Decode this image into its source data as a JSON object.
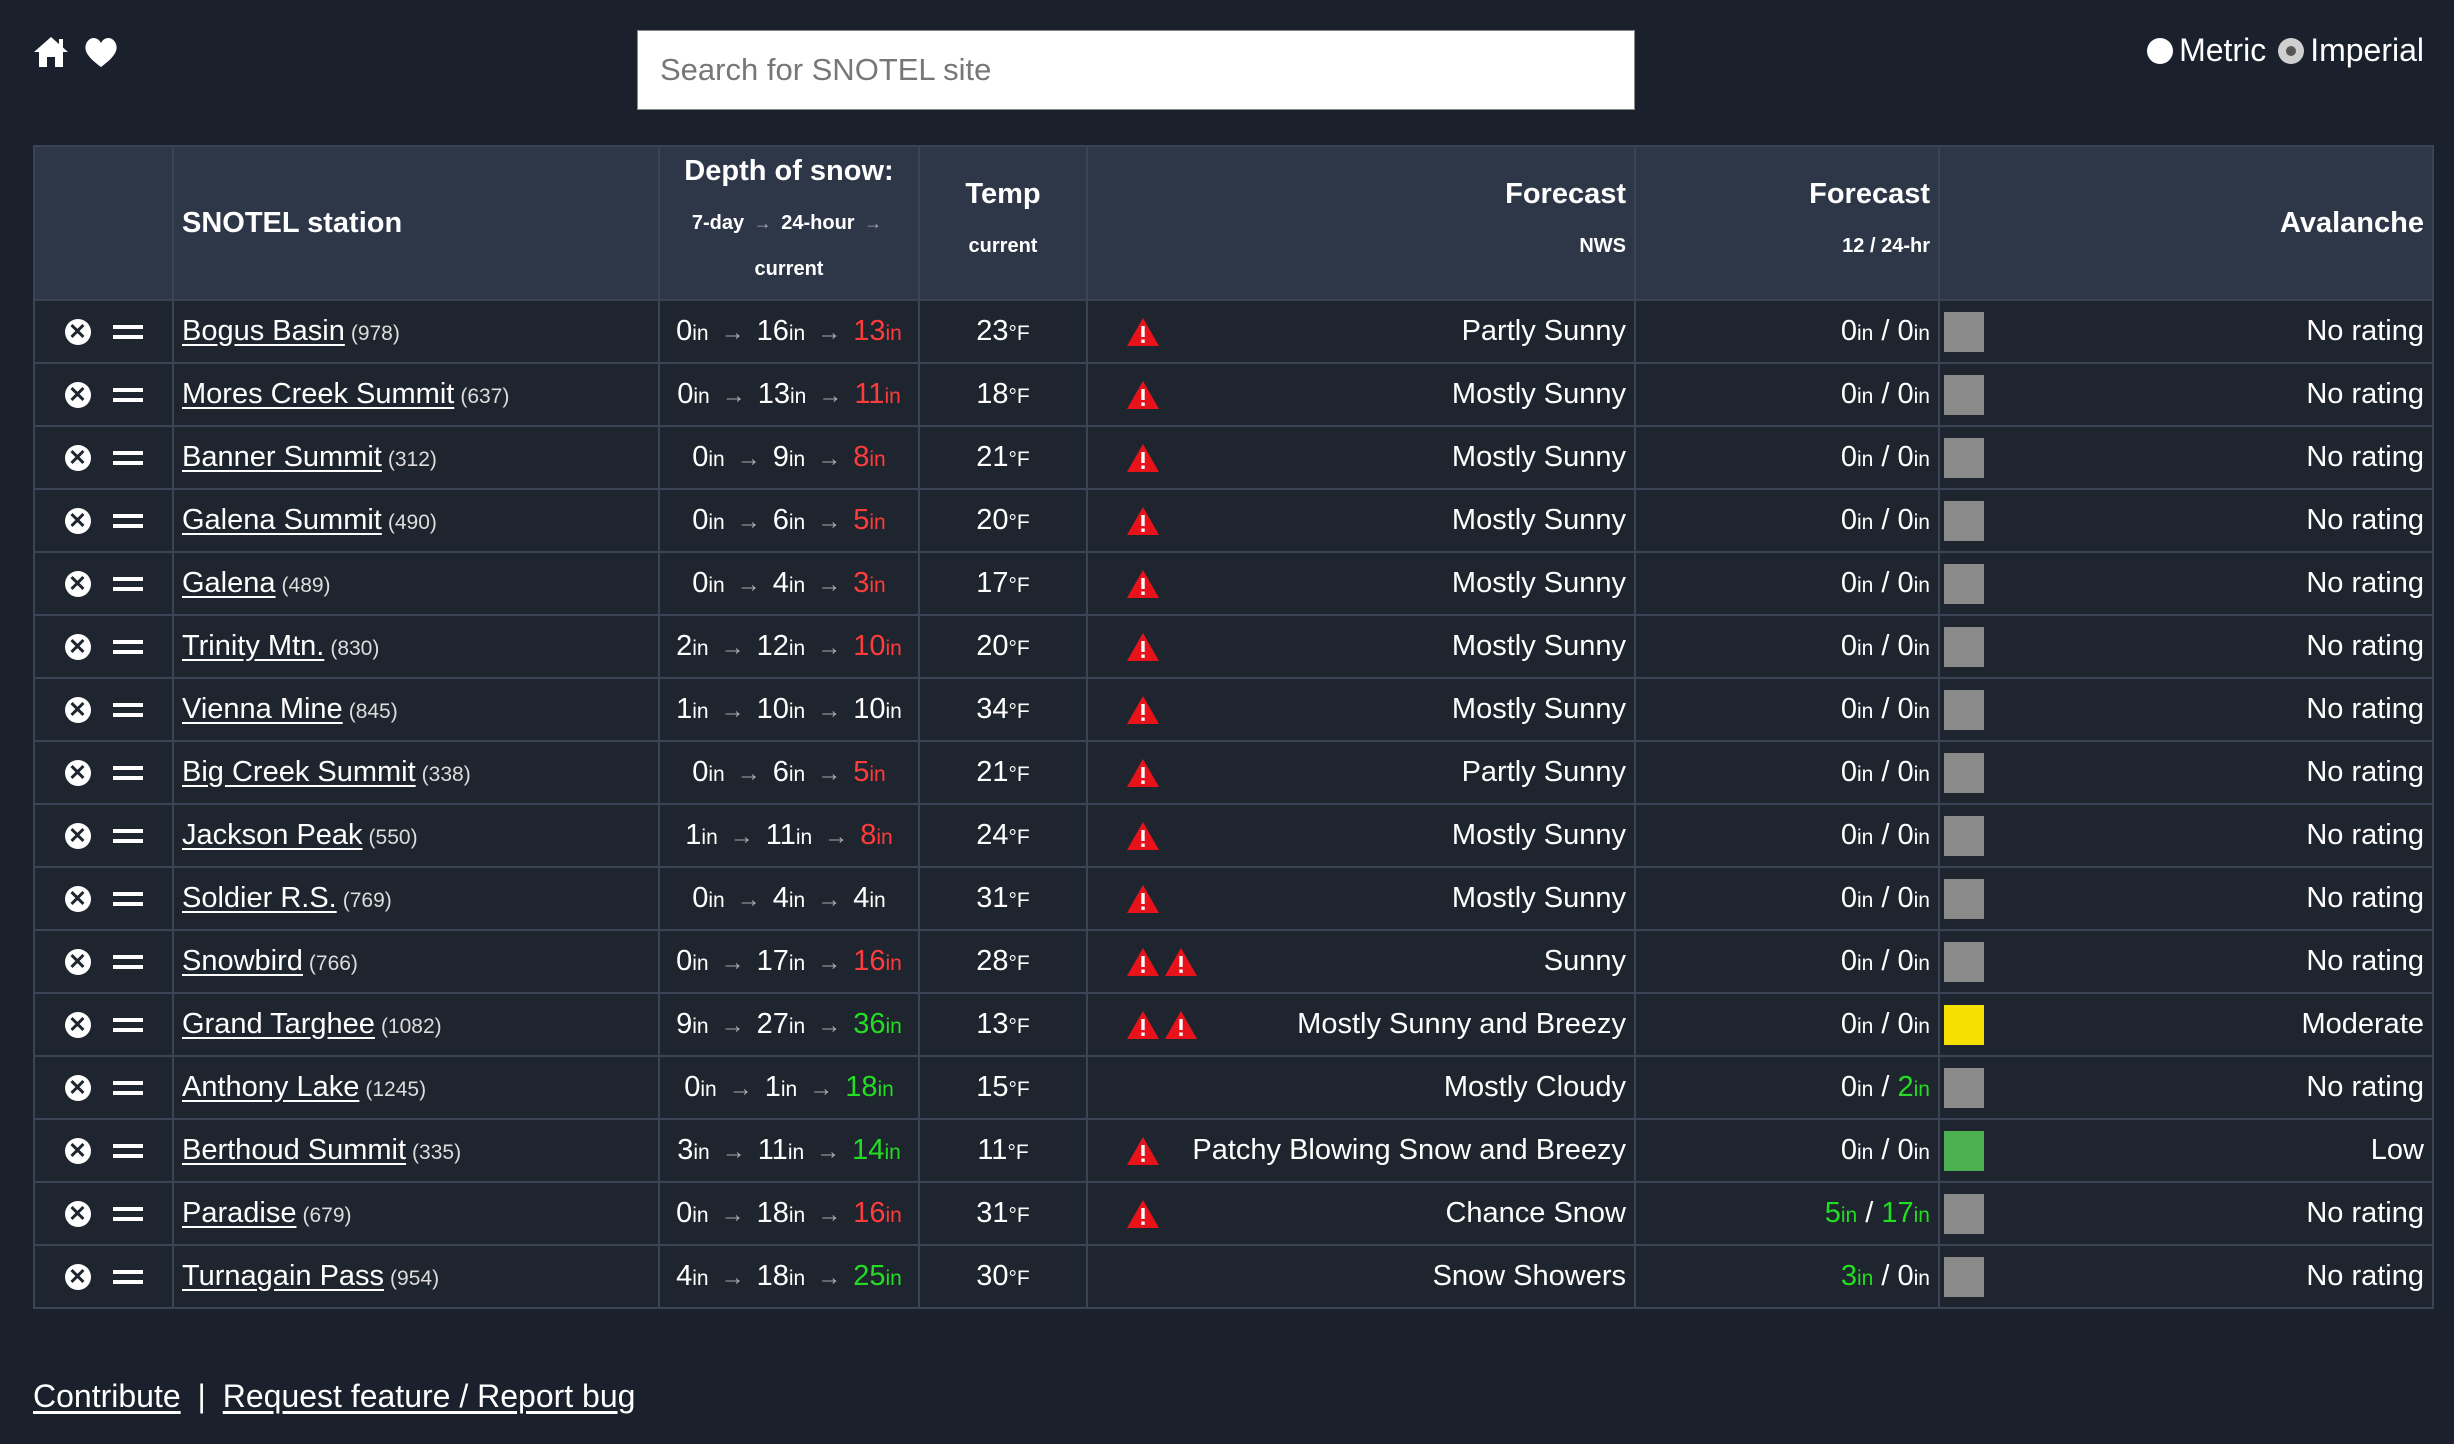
{
  "header": {
    "search_placeholder": "Search for SNOTEL site",
    "units": {
      "metric_label": "Metric",
      "imperial_label": "Imperial",
      "selected": "imperial"
    }
  },
  "table": {
    "headers": {
      "station": "SNOTEL station",
      "depth_title": "Depth of snow:",
      "depth_sub1": "7-day",
      "depth_sub2": "24-hour",
      "depth_sub3": "current",
      "temp_title": "Temp",
      "temp_sub": "current",
      "forecast_title": "Forecast",
      "forecast_sub": "NWS",
      "forecast2_title": "Forecast",
      "forecast2_sub": "12 / 24-hr",
      "avalanche_title": "Avalanche"
    },
    "depth_unit": "in",
    "temp_unit": "°F",
    "colors": {
      "decrease": "#ff3b3b",
      "increase": "#22dd22",
      "neutral": "#ffffff",
      "no_rating": "#8a8a8a",
      "moderate": "#f5e000",
      "low": "#4caf50"
    },
    "rows": [
      {
        "name": "Bogus Basin",
        "id": "(978)",
        "d7": "0",
        "d24": "16",
        "cur": "13",
        "trend": "down",
        "temp": "23",
        "warnings": 1,
        "forecast": "Partly Sunny",
        "f12": "0",
        "f24": "0",
        "f12_hl": false,
        "f24_hl": false,
        "avalanche": "No rating",
        "av_level": "none"
      },
      {
        "name": "Mores Creek Summit",
        "id": "(637)",
        "d7": "0",
        "d24": "13",
        "cur": "11",
        "trend": "down",
        "temp": "18",
        "warnings": 1,
        "forecast": "Mostly Sunny",
        "f12": "0",
        "f24": "0",
        "f12_hl": false,
        "f24_hl": false,
        "avalanche": "No rating",
        "av_level": "none"
      },
      {
        "name": "Banner Summit",
        "id": "(312)",
        "d7": "0",
        "d24": "9",
        "cur": "8",
        "trend": "down",
        "temp": "21",
        "warnings": 1,
        "forecast": "Mostly Sunny",
        "f12": "0",
        "f24": "0",
        "f12_hl": false,
        "f24_hl": false,
        "avalanche": "No rating",
        "av_level": "none"
      },
      {
        "name": "Galena Summit",
        "id": "(490)",
        "d7": "0",
        "d24": "6",
        "cur": "5",
        "trend": "down",
        "temp": "20",
        "warnings": 1,
        "forecast": "Mostly Sunny",
        "f12": "0",
        "f24": "0",
        "f12_hl": false,
        "f24_hl": false,
        "avalanche": "No rating",
        "av_level": "none"
      },
      {
        "name": "Galena",
        "id": "(489)",
        "d7": "0",
        "d24": "4",
        "cur": "3",
        "trend": "down",
        "temp": "17",
        "warnings": 1,
        "forecast": "Mostly Sunny",
        "f12": "0",
        "f24": "0",
        "f12_hl": false,
        "f24_hl": false,
        "avalanche": "No rating",
        "av_level": "none"
      },
      {
        "name": "Trinity Mtn.",
        "id": "(830)",
        "d7": "2",
        "d24": "12",
        "cur": "10",
        "trend": "down",
        "temp": "20",
        "warnings": 1,
        "forecast": "Mostly Sunny",
        "f12": "0",
        "f24": "0",
        "f12_hl": false,
        "f24_hl": false,
        "avalanche": "No rating",
        "av_level": "none"
      },
      {
        "name": "Vienna Mine",
        "id": "(845)",
        "d7": "1",
        "d24": "10",
        "cur": "10",
        "trend": "same",
        "temp": "34",
        "warnings": 1,
        "forecast": "Mostly Sunny",
        "f12": "0",
        "f24": "0",
        "f12_hl": false,
        "f24_hl": false,
        "avalanche": "No rating",
        "av_level": "none"
      },
      {
        "name": "Big Creek Summit",
        "id": "(338)",
        "d7": "0",
        "d24": "6",
        "cur": "5",
        "trend": "down",
        "temp": "21",
        "warnings": 1,
        "forecast": "Partly Sunny",
        "f12": "0",
        "f24": "0",
        "f12_hl": false,
        "f24_hl": false,
        "avalanche": "No rating",
        "av_level": "none"
      },
      {
        "name": "Jackson Peak",
        "id": "(550)",
        "d7": "1",
        "d24": "11",
        "cur": "8",
        "trend": "down",
        "temp": "24",
        "warnings": 1,
        "forecast": "Mostly Sunny",
        "f12": "0",
        "f24": "0",
        "f12_hl": false,
        "f24_hl": false,
        "avalanche": "No rating",
        "av_level": "none"
      },
      {
        "name": "Soldier R.S.",
        "id": "(769)",
        "d7": "0",
        "d24": "4",
        "cur": "4",
        "trend": "same",
        "temp": "31",
        "warnings": 1,
        "forecast": "Mostly Sunny",
        "f12": "0",
        "f24": "0",
        "f12_hl": false,
        "f24_hl": false,
        "avalanche": "No rating",
        "av_level": "none"
      },
      {
        "name": "Snowbird",
        "id": "(766)",
        "d7": "0",
        "d24": "17",
        "cur": "16",
        "trend": "down",
        "temp": "28",
        "warnings": 2,
        "forecast": "Sunny",
        "f12": "0",
        "f24": "0",
        "f12_hl": false,
        "f24_hl": false,
        "avalanche": "No rating",
        "av_level": "none"
      },
      {
        "name": "Grand Targhee",
        "id": "(1082)",
        "d7": "9",
        "d24": "27",
        "cur": "36",
        "trend": "up",
        "temp": "13",
        "warnings": 2,
        "forecast": "Mostly Sunny and Breezy",
        "f12": "0",
        "f24": "0",
        "f12_hl": false,
        "f24_hl": false,
        "avalanche": "Moderate",
        "av_level": "moderate"
      },
      {
        "name": "Anthony Lake",
        "id": "(1245)",
        "d7": "0",
        "d24": "1",
        "cur": "18",
        "trend": "up",
        "temp": "15",
        "warnings": 0,
        "forecast": "Mostly Cloudy",
        "f12": "0",
        "f24": "2",
        "f12_hl": false,
        "f24_hl": true,
        "avalanche": "No rating",
        "av_level": "none"
      },
      {
        "name": "Berthoud Summit",
        "id": "(335)",
        "d7": "3",
        "d24": "11",
        "cur": "14",
        "trend": "up",
        "temp": "11",
        "warnings": 1,
        "forecast": "Patchy Blowing Snow and Breezy",
        "f12": "0",
        "f24": "0",
        "f12_hl": false,
        "f24_hl": false,
        "avalanche": "Low",
        "av_level": "low"
      },
      {
        "name": "Paradise",
        "id": "(679)",
        "d7": "0",
        "d24": "18",
        "cur": "16",
        "trend": "down",
        "temp": "31",
        "warnings": 1,
        "forecast": "Chance Snow",
        "f12": "5",
        "f24": "17",
        "f12_hl": true,
        "f24_hl": true,
        "avalanche": "No rating",
        "av_level": "none"
      },
      {
        "name": "Turnagain Pass",
        "id": "(954)",
        "d7": "4",
        "d24": "18",
        "cur": "25",
        "trend": "up",
        "temp": "30",
        "warnings": 0,
        "forecast": "Snow Showers",
        "f12": "3",
        "f24": "0",
        "f12_hl": true,
        "f24_hl": false,
        "avalanche": "No rating",
        "av_level": "none"
      }
    ]
  },
  "footer": {
    "contribute": "Contribute",
    "separator": "|",
    "report": "Request feature / Report bug"
  }
}
